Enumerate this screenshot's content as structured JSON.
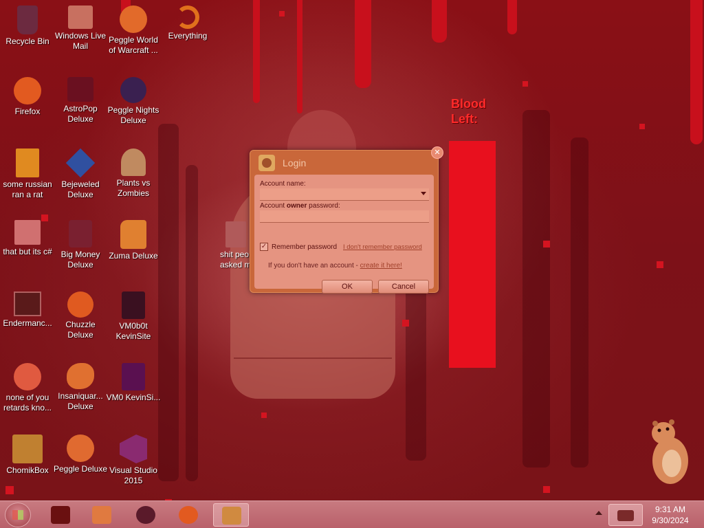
{
  "desktop": {
    "icons": [
      {
        "label": "Recycle Bin",
        "icon": "recycle-bin-icon",
        "color": "#6c2a40"
      },
      {
        "label": "Windows Live Mail",
        "icon": "mail-icon",
        "color": "#c87060"
      },
      {
        "label": "Peggle World of Warcraft ...",
        "icon": "peggle-wow-icon",
        "color": "#e26a2a"
      },
      {
        "label": "Everything",
        "icon": "everything-icon",
        "color": "#e0701c"
      },
      {
        "label": "Firefox",
        "icon": "firefox-icon",
        "color": "#e25a20"
      },
      {
        "label": "AstroPop Deluxe",
        "icon": "astropop-icon",
        "color": "#6a1020"
      },
      {
        "label": "Peggle Nights Deluxe",
        "icon": "peggle-nights-icon",
        "color": "#3a2050"
      },
      {
        "label": "some russian ran a rat",
        "icon": "document-icon",
        "color": "#e08a20"
      },
      {
        "label": "Bejeweled Deluxe",
        "icon": "bejeweled-icon",
        "color": "#3050a0"
      },
      {
        "label": "Plants vs Zombies",
        "icon": "pvz-icon",
        "color": "#c08a60"
      },
      {
        "label": "that but its c#",
        "icon": "folder-icon",
        "color": "#d07070"
      },
      {
        "label": "Big Money Deluxe",
        "icon": "big-money-icon",
        "color": "#7a2030"
      },
      {
        "label": "Zuma Deluxe",
        "icon": "zuma-icon",
        "color": "#e08030"
      },
      {
        "label": "Endermanc...",
        "icon": "enderman-icon",
        "color": "#5a1a1a"
      },
      {
        "label": "Chuzzle Deluxe",
        "icon": "chuzzle-icon",
        "color": "#e05a20"
      },
      {
        "label": "VM0b0t KevinSite",
        "icon": "vm-icon",
        "color": "#3a1020"
      },
      {
        "label": "none of you retards kno...",
        "icon": "chrome-icon",
        "color": "#e05a40"
      },
      {
        "label": "Insaniquar... Deluxe",
        "icon": "insaniquarium-icon",
        "color": "#e07030"
      },
      {
        "label": "VM0 KevinSi...",
        "icon": "vm-icon",
        "color": "#5a1050"
      },
      {
        "label": "ChomikBox",
        "icon": "chomikbox-icon",
        "color": "#c08030"
      },
      {
        "label": "Peggle Deluxe",
        "icon": "peggle-icon",
        "color": "#e06a30"
      },
      {
        "label": "Visual Studio 2015",
        "icon": "visual-studio-icon",
        "color": "#8a2a70"
      }
    ],
    "partial_icon_label": "shit peo asked m"
  },
  "blood": {
    "title_line1": "Blood",
    "title_line2": "Left:",
    "level": 1.0,
    "color": "#e8101e"
  },
  "dialog": {
    "title": "Login",
    "account_name_label": "Account name:",
    "password_label_pre": "Account ",
    "password_label_bold": "owner",
    "password_label_post": " password:",
    "remember_label": "Remember password",
    "remember_checked": true,
    "forgot_link": "I don't remember password",
    "no_account_text": "If you don't have an account - ",
    "create_link": "create it here!",
    "ok_label": "OK",
    "cancel_label": "Cancel"
  },
  "taskbar": {
    "items": [
      {
        "icon": "cube-icon",
        "color": "#6a1010"
      },
      {
        "icon": "media-player-icon",
        "color": "#e07a40"
      },
      {
        "icon": "globe-icon",
        "color": "#5a1a2a"
      },
      {
        "icon": "firefox-icon",
        "color": "#e25a20"
      },
      {
        "icon": "chomikbox-icon",
        "color": "#d08a40",
        "active": true
      }
    ],
    "time": "9:31 AM",
    "date": "9/30/2024"
  }
}
